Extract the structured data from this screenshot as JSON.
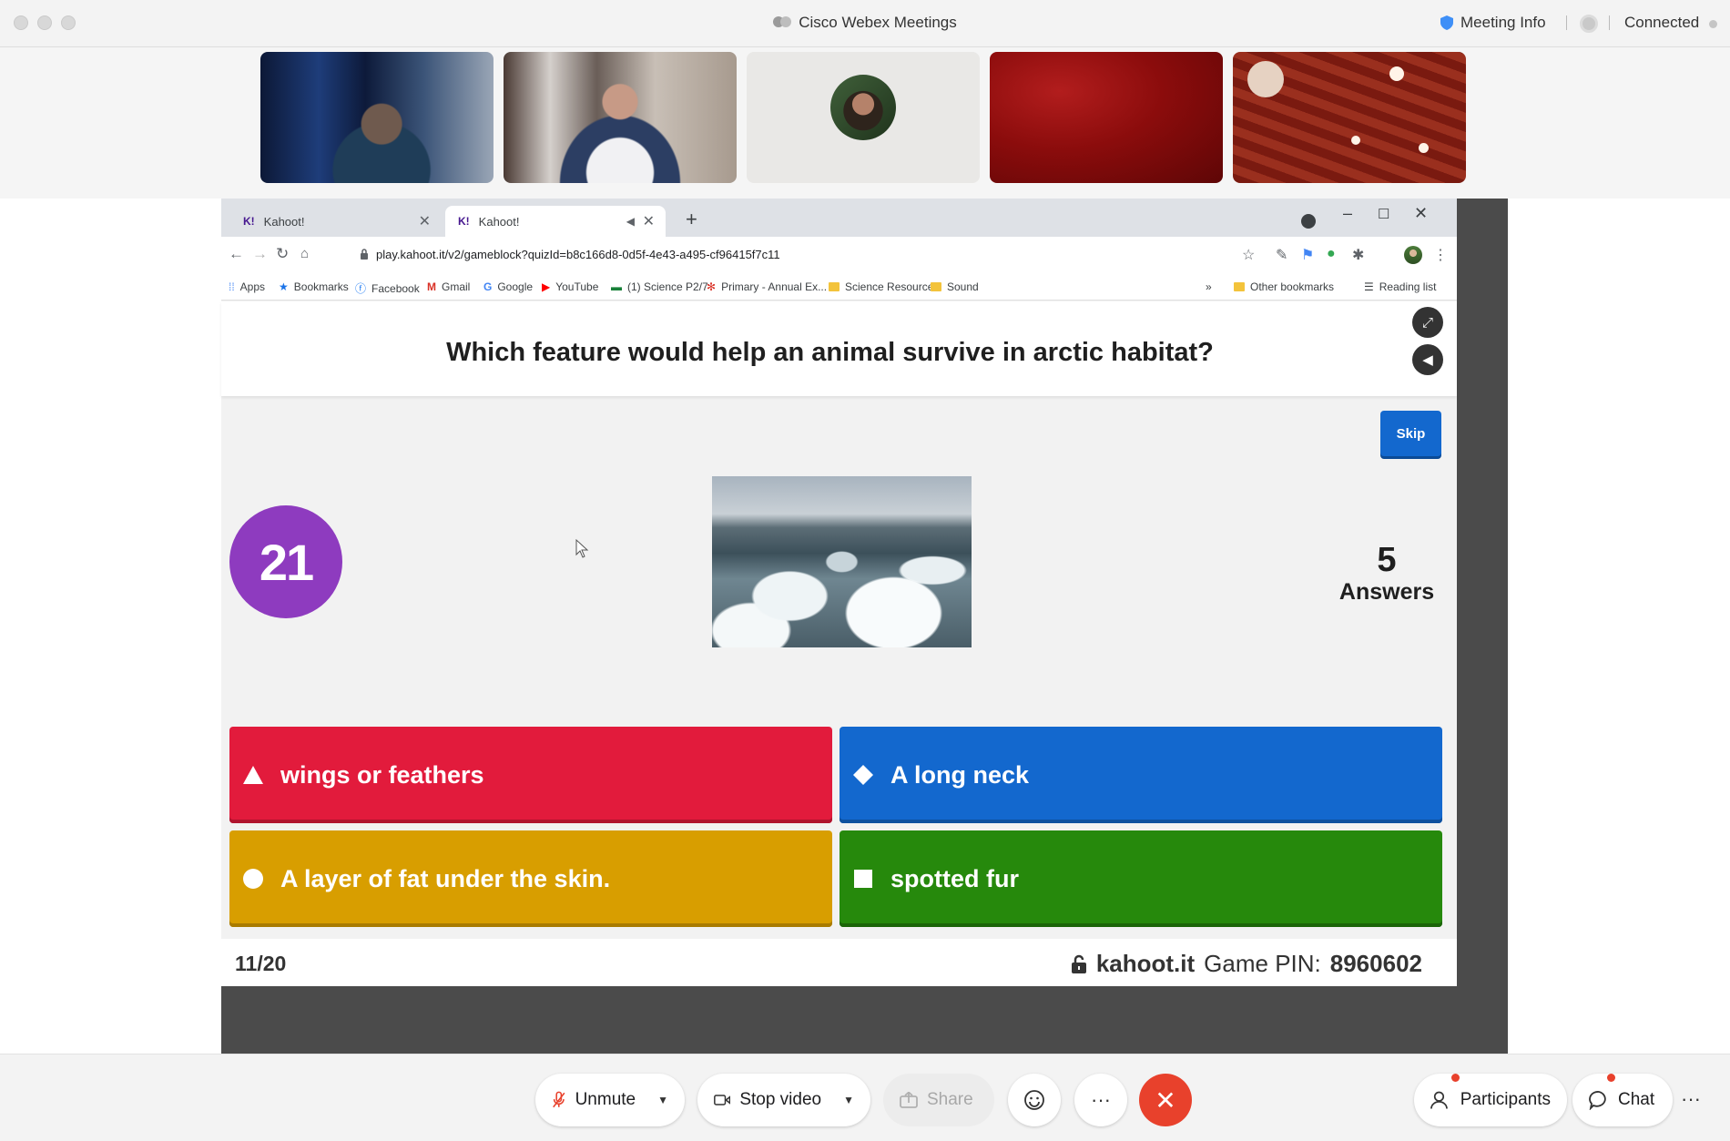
{
  "window": {
    "title": "Cisco Webex Meetings",
    "meeting_info": "Meeting Info",
    "status": "Connected"
  },
  "browser": {
    "tabs": [
      {
        "label": "Kahoot!"
      },
      {
        "label": "Kahoot!"
      }
    ],
    "url": "play.kahoot.it/v2/gameblock?quizId=b8c166d8-0d5f-4e43-a495-cf96415f7c11",
    "bookmarks": [
      {
        "label": "Apps"
      },
      {
        "label": "Bookmarks"
      },
      {
        "label": "Facebook"
      },
      {
        "label": "Gmail"
      },
      {
        "label": "Google"
      },
      {
        "label": "YouTube"
      },
      {
        "label": "(1) Science P2/7"
      },
      {
        "label": "Primary - Annual Ex..."
      },
      {
        "label": "Science Resource"
      },
      {
        "label": "Sound"
      }
    ],
    "more_bookmarks": "»",
    "other_bookmarks": "Other bookmarks",
    "reading_list": "Reading list"
  },
  "kahoot": {
    "question": "Which feature would help an animal survive in arctic habitat?",
    "skip_label": "Skip",
    "timer": "21",
    "answers_count": "5",
    "answers_label": "Answers",
    "options": [
      {
        "label": "wings or feathers",
        "shape": "triangle-icon",
        "color": "#e21b3c"
      },
      {
        "label": "A long neck",
        "shape": "diamond-icon",
        "color": "#1368ce"
      },
      {
        "label": "A layer of fat under the skin.",
        "shape": "circle-icon",
        "color": "#d89e00"
      },
      {
        "label": "spotted fur",
        "shape": "square-icon",
        "color": "#26890c"
      }
    ],
    "progress": "11/20",
    "site": "kahoot.it",
    "pin_label": "Game PIN:",
    "pin": "8960602"
  },
  "controls": {
    "unmute": "Unmute",
    "stop_video": "Stop video",
    "share": "Share",
    "participants": "Participants",
    "chat": "Chat"
  },
  "colors": {
    "timer_purple": "#8e3bbf",
    "skip_blue": "#1368ce",
    "leave_red": "#e8412c"
  }
}
